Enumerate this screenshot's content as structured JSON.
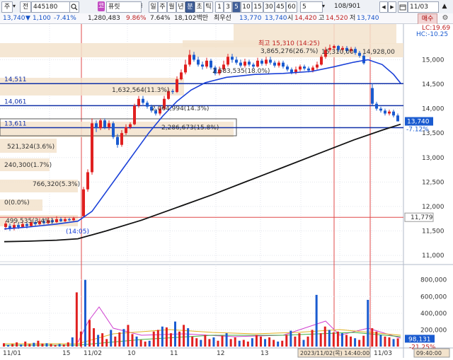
{
  "toolbar": {
    "market": "주",
    "market_dropdown": "▾",
    "scope": "전",
    "code": "445180",
    "search_icon": "search-icon",
    "badge": "코",
    "name": "퓨릿",
    "dots": "⁝",
    "periods": [
      "일",
      "주",
      "월",
      "년",
      "분",
      "초",
      "틱"
    ],
    "active_period": "분",
    "intervals": [
      "1",
      "3",
      "5",
      "10",
      "15",
      "30",
      "45",
      "60"
    ],
    "active_interval": "5",
    "interval_input": "5",
    "count": "108/901",
    "date": "11/03"
  },
  "quote": {
    "price": "13,740",
    "arrow": "▼",
    "change": "1,100",
    "change_pct": "-7.41%",
    "volume": "1,280,483",
    "ratio1": "9.86%",
    "ratio2": "7.64%",
    "amount": "18,102백만",
    "priority_label": "최우선",
    "priority": "13,770",
    "ask_price": "13,740",
    "open_label": "시",
    "open": "14,420",
    "high_label": "고",
    "high": "14,520",
    "low_label": "저",
    "low": "13,740",
    "buy_button": "매수"
  },
  "chart_data": {
    "type": "candlestick",
    "y_ticks": [
      "15,000",
      "14,500",
      "14,000",
      "13,500",
      "13,000",
      "12,500",
      "12,000",
      "11,500",
      "11,000"
    ],
    "ylim": [
      10900,
      15700
    ],
    "current_price": "13,740",
    "current_pct": "-7.12%",
    "marked_price": "11,779",
    "lc_label": "LC:19.69",
    "hc_label": "HC:-10.25",
    "horizontal_levels": [
      {
        "label": "14,511",
        "value": 14511
      },
      {
        "label": "14,061",
        "value": 14061
      },
      {
        "label": "13,611",
        "value": 13611
      }
    ],
    "volume_profile": [
      {
        "label": "499,535(3.4%)"
      },
      {
        "label": "0(0.0%)"
      },
      {
        "label": "766,320(5.3%)"
      },
      {
        "label": "240,300(1.7%)"
      },
      {
        "label": "521,324(3.6%)"
      },
      {
        "label": "2,286,673(15.8%)"
      },
      {
        "label": "2,064,994(14.3%)"
      },
      {
        "label": "1,632,564(11.3%)"
      },
      {
        "label": "2,583,535(18.0%)"
      },
      {
        "label": "3,865,276(26.7%)"
      }
    ],
    "annotations": {
      "high": "최고 15,310 (14:25)",
      "low_time": "(14:05)",
      "mid_labels": [
        "15,310,00",
        "14,928,00"
      ]
    },
    "x_labels": [
      "11/01",
      "15",
      "11/02",
      "10",
      "11",
      "12",
      "13",
      "2023/11/02(목) 14:40:00",
      "11/03",
      "09:40:00"
    ],
    "volume_ticks": [
      "800,000",
      "600,000",
      "400,000",
      "200,000"
    ],
    "volume_current": "98,131",
    "volume_pct": "-21.25%"
  }
}
